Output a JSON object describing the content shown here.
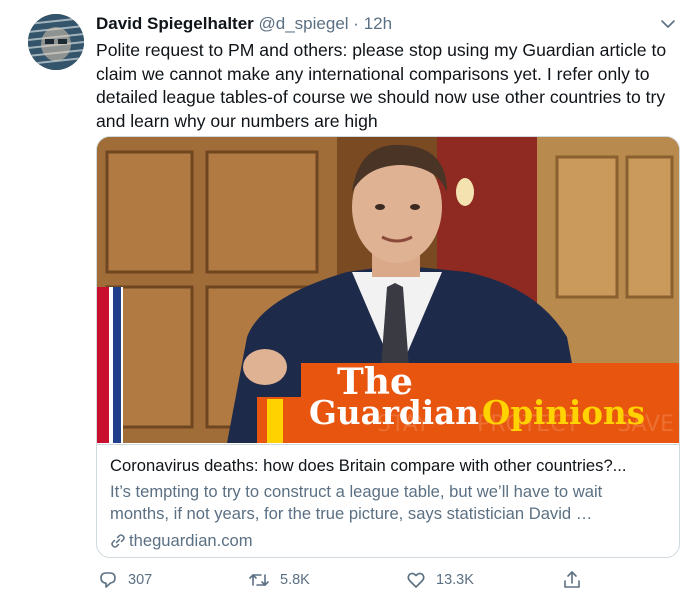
{
  "tweet": {
    "author_name": "David Spiegelhalter",
    "handle": "@d_spiegel",
    "separator": "·",
    "time": "12h",
    "text": "Polite request to PM and others: please stop using my Guardian article to claim we cannot make any international comparisons yet. I refer only to detailed league tables-of course we should now use other countries to try and learn why our numbers are high"
  },
  "card": {
    "logo_line1": "The",
    "logo_line2": "Guardian",
    "logo_line3": "Opinions",
    "background_words": [
      "STAY",
      "PROTECT",
      "SAVE"
    ],
    "title": "Coronavirus deaths: how does Britain compare with other countries?...",
    "description": "It’s tempting to try to construct a league table, but we’ll have to wait months, if not years, for the true picture, says statistician David …",
    "domain": "theguardian.com"
  },
  "actions": {
    "replies": "307",
    "retweets": "5.8K",
    "likes": "13.3K"
  },
  "colors": {
    "guardian_orange": "#e8550e",
    "muted_text": "#5b7083",
    "border": "#cfd9de"
  },
  "icons": [
    "caret-down-icon",
    "link-icon",
    "reply-icon",
    "retweet-icon",
    "like-icon",
    "share-icon"
  ]
}
